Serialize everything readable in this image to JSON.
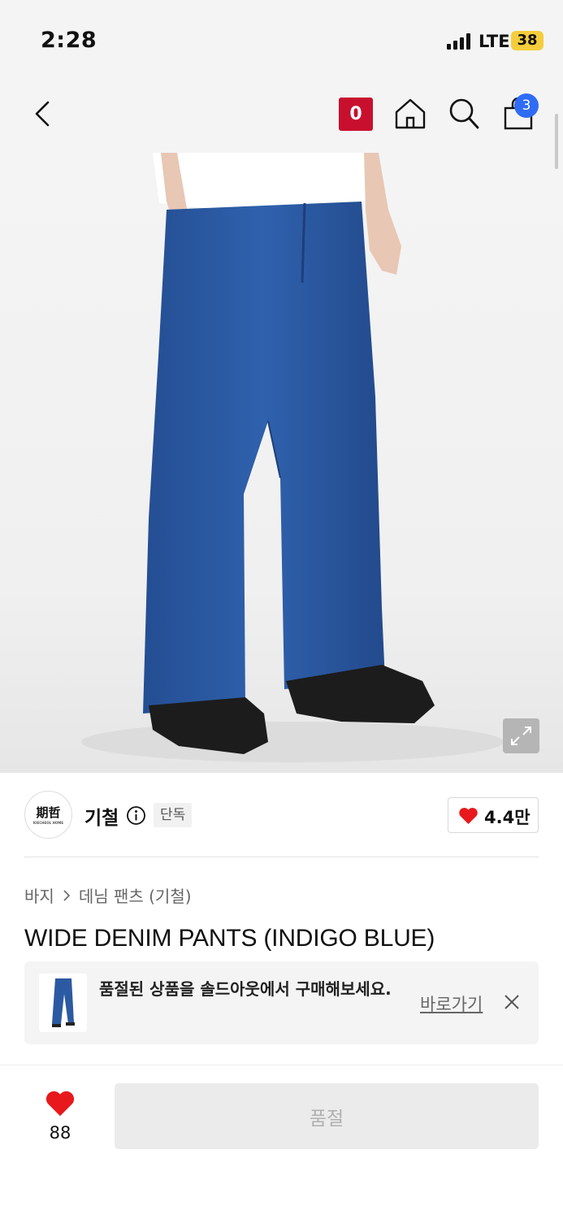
{
  "status_bar": {
    "time": "2:28",
    "network": "LTE",
    "battery": "38"
  },
  "header": {
    "live_badge": "0",
    "cart_count": "3"
  },
  "brand": {
    "logo_text": "期哲",
    "logo_subtext": "KIECHEOL HOME",
    "name": "기철",
    "tag": "단독",
    "likes": "4.4만"
  },
  "breadcrumb": [
    "바지",
    "데님 팬츠 (기철)"
  ],
  "product": {
    "title": "WIDE DENIM PANTS (INDIGO BLUE)"
  },
  "soldout_banner": {
    "message": "품절된 상품을 솔드아웃에서 구매해보세요.",
    "link_label": "바로가기"
  },
  "bottom_bar": {
    "wish_count": "88",
    "buy_label": "품절"
  },
  "colors": {
    "accent_red": "#c8102e",
    "heart": "#e8191d",
    "badge_blue": "#2f6cf6",
    "denim": "#2b5aa3"
  }
}
